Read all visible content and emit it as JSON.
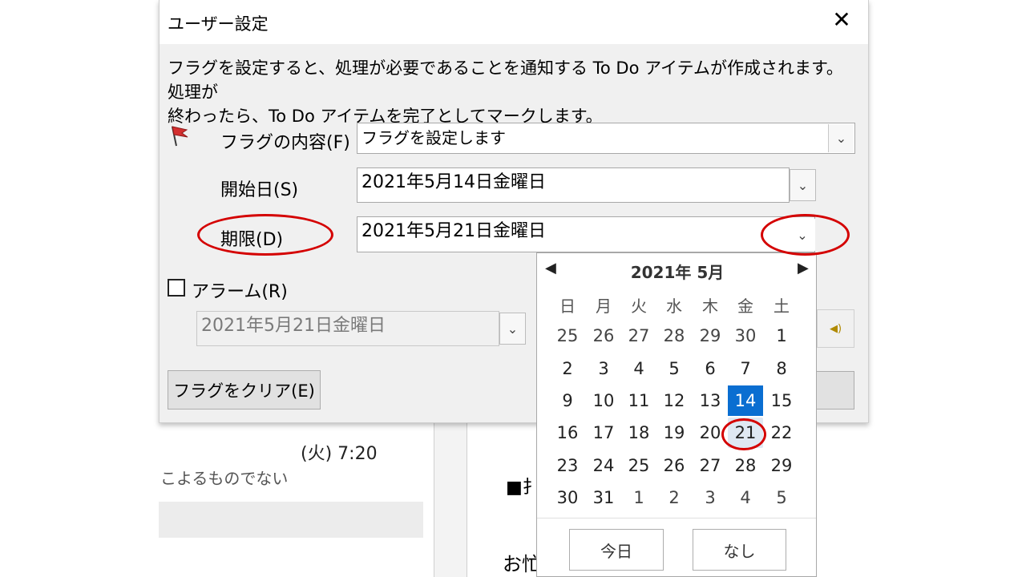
{
  "background": {
    "time_text": "(火) 7:20",
    "snippet_text": "こよるものでない",
    "square_text": "■扌",
    "greeting_text": "お忙"
  },
  "dialog": {
    "title": "ユーザー設定",
    "close_symbol": "✕",
    "description": "フラグを設定すると、処理が必要であることを通知する To Do アイテムが作成されます。処理が\n終わったら、To Do アイテムを完了としてマークします。",
    "flag_to": {
      "label": "フラグの内容(F)",
      "value": "フラグを設定します",
      "icon": "red-flag-icon"
    },
    "start_date": {
      "label": "開始日(S)",
      "value": "2021年5月14日金曜日"
    },
    "due_date": {
      "label": "期限(D)",
      "value": "2021年5月21日金曜日"
    },
    "reminder": {
      "label": "アラーム(R)",
      "checked": false,
      "date_value": "2021年5月21日金曜日",
      "sound_icon": "speaker-icon"
    },
    "clear_flag_button": "フラグをクリア(E)"
  },
  "calendar": {
    "month_title": "2021年 5月",
    "prev_symbol": "◀",
    "next_symbol": "▶",
    "weekdays": [
      "日",
      "月",
      "火",
      "水",
      "木",
      "金",
      "土"
    ],
    "weeks": [
      [
        "25",
        "26",
        "27",
        "28",
        "29",
        "30",
        "1"
      ],
      [
        "2",
        "3",
        "4",
        "5",
        "6",
        "7",
        "8"
      ],
      [
        "9",
        "10",
        "11",
        "12",
        "13",
        "14",
        "15"
      ],
      [
        "16",
        "17",
        "18",
        "19",
        "20",
        "21",
        "22"
      ],
      [
        "23",
        "24",
        "25",
        "26",
        "27",
        "28",
        "29"
      ],
      [
        "30",
        "31",
        "1",
        "2",
        "3",
        "4",
        "5"
      ]
    ],
    "selected_day": "14",
    "highlighted_day": "21",
    "today_button": "今日",
    "none_button": "なし"
  },
  "colors": {
    "selection": "#0a6ed1",
    "annotation": "#d40000",
    "flag": "#d32f2f"
  }
}
